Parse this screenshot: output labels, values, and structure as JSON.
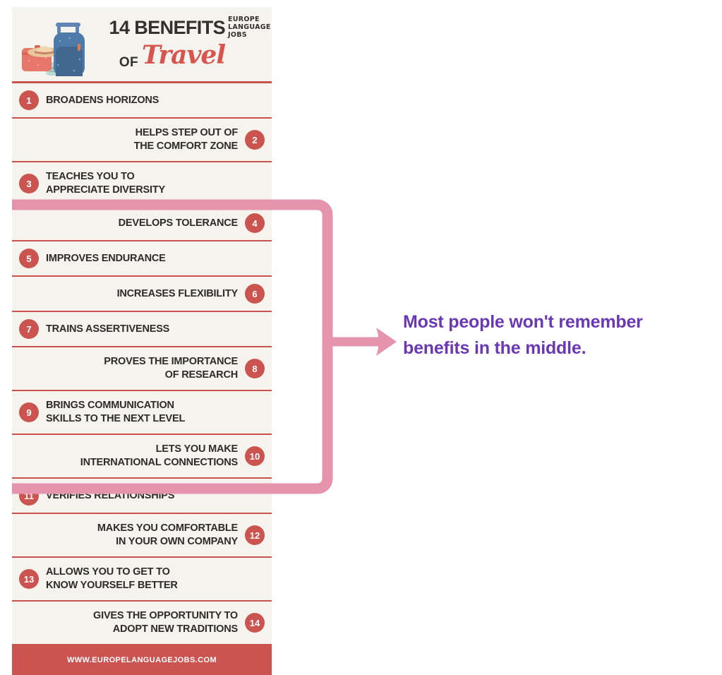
{
  "infographic": {
    "header": {
      "title_main": "14 BENEFITS",
      "title_of": "OF",
      "title_script": "Travel",
      "brand_line1": "EUROPE",
      "brand_line2": "LANGUAGE",
      "brand_line3": "JOBS",
      "illustration_name": "travel-luggage-illustration"
    },
    "items": [
      {
        "number": "1",
        "text": "BROADENS HORIZONS",
        "side": "left",
        "lines": 1
      },
      {
        "number": "2",
        "text": "HELPS STEP OUT OF\nTHE COMFORT ZONE",
        "side": "right",
        "lines": 2
      },
      {
        "number": "3",
        "text": "TEACHES YOU TO\nAPPRECIATE DIVERSITY",
        "side": "left",
        "lines": 2
      },
      {
        "number": "4",
        "text": "DEVELOPS TOLERANCE",
        "side": "right",
        "lines": 1
      },
      {
        "number": "5",
        "text": "IMPROVES ENDURANCE",
        "side": "left",
        "lines": 1
      },
      {
        "number": "6",
        "text": "INCREASES FLEXIBILITY",
        "side": "right",
        "lines": 1
      },
      {
        "number": "7",
        "text": "TRAINS ASSERTIVENESS",
        "side": "left",
        "lines": 1
      },
      {
        "number": "8",
        "text": "PROVES THE IMPORTANCE\nOF RESEARCH",
        "side": "right",
        "lines": 2
      },
      {
        "number": "9",
        "text": "BRINGS COMMUNICATION\nSKILLS TO THE NEXT LEVEL",
        "side": "left",
        "lines": 2
      },
      {
        "number": "10",
        "text": "LETS YOU MAKE\nINTERNATIONAL CONNECTIONS",
        "side": "right",
        "lines": 2
      },
      {
        "number": "11",
        "text": "VERIFIES RELATIONSHIPS",
        "side": "left",
        "lines": 1
      },
      {
        "number": "12",
        "text": "MAKES YOU COMFORTABLE\nIN YOUR OWN COMPANY",
        "side": "right",
        "lines": 2
      },
      {
        "number": "13",
        "text": "ALLOWS YOU TO GET TO\nKNOW YOURSELF BETTER",
        "side": "left",
        "lines": 2
      },
      {
        "number": "14",
        "text": "GIVES THE OPPORTUNITY TO\nADOPT NEW TRADITIONS",
        "side": "right",
        "lines": 2
      }
    ],
    "footer_url": "WWW.EUROPELANGUAGEJOBS.COM"
  },
  "annotation": {
    "text": "Most people won't remember\nbenefits in the middle.",
    "color": "#6a37b5",
    "highlight_range": "items 4 through 11"
  },
  "colors": {
    "card_background": "#f4f3ee",
    "accent_red": "#cb5450",
    "separator_red": "#c9534f",
    "pink_bracket": "#e694ae",
    "text_dark": "#2e2b29",
    "annotation_purple": "#6a37b5",
    "page_background": "#ffffff"
  }
}
